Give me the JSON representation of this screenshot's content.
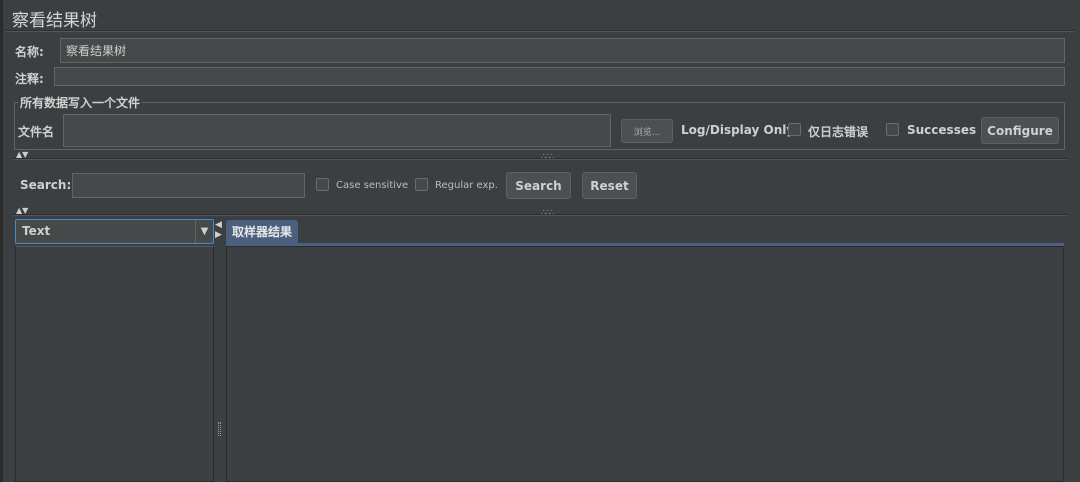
{
  "title": "察看结果树",
  "name_label": "名称:",
  "name_value": "察看结果树",
  "comment_label": "注释:",
  "comment_value": "",
  "file_group": {
    "title": "所有数据写入一个文件",
    "filename_label": "文件名",
    "filename_value": "",
    "browse_label": "浏览...",
    "log_display_label": "Log/Display Only:",
    "errors_label": "仅日志错误",
    "errors_checked": false,
    "successes_label": "Successes",
    "successes_checked": false,
    "configure_label": "Configure"
  },
  "search": {
    "label": "Search:",
    "value": "",
    "case_sensitive_label": "Case sensitive",
    "case_sensitive_checked": false,
    "regex_label": "Regular exp.",
    "regex_checked": false,
    "search_button": "Search",
    "reset_button": "Reset"
  },
  "renderer": {
    "selected": "Text"
  },
  "tabs": [
    {
      "label": "取样器结果",
      "active": true
    }
  ],
  "icons": {
    "split_arrows": "up-down-arrows-icon",
    "grip": "splitter-grip-icon",
    "dropdown": "chevron-down-icon"
  },
  "colors": {
    "background": "#3c3f41",
    "field": "#45494a",
    "tab_active": "#4b5f7e",
    "focus_border": "#4a88c7"
  }
}
